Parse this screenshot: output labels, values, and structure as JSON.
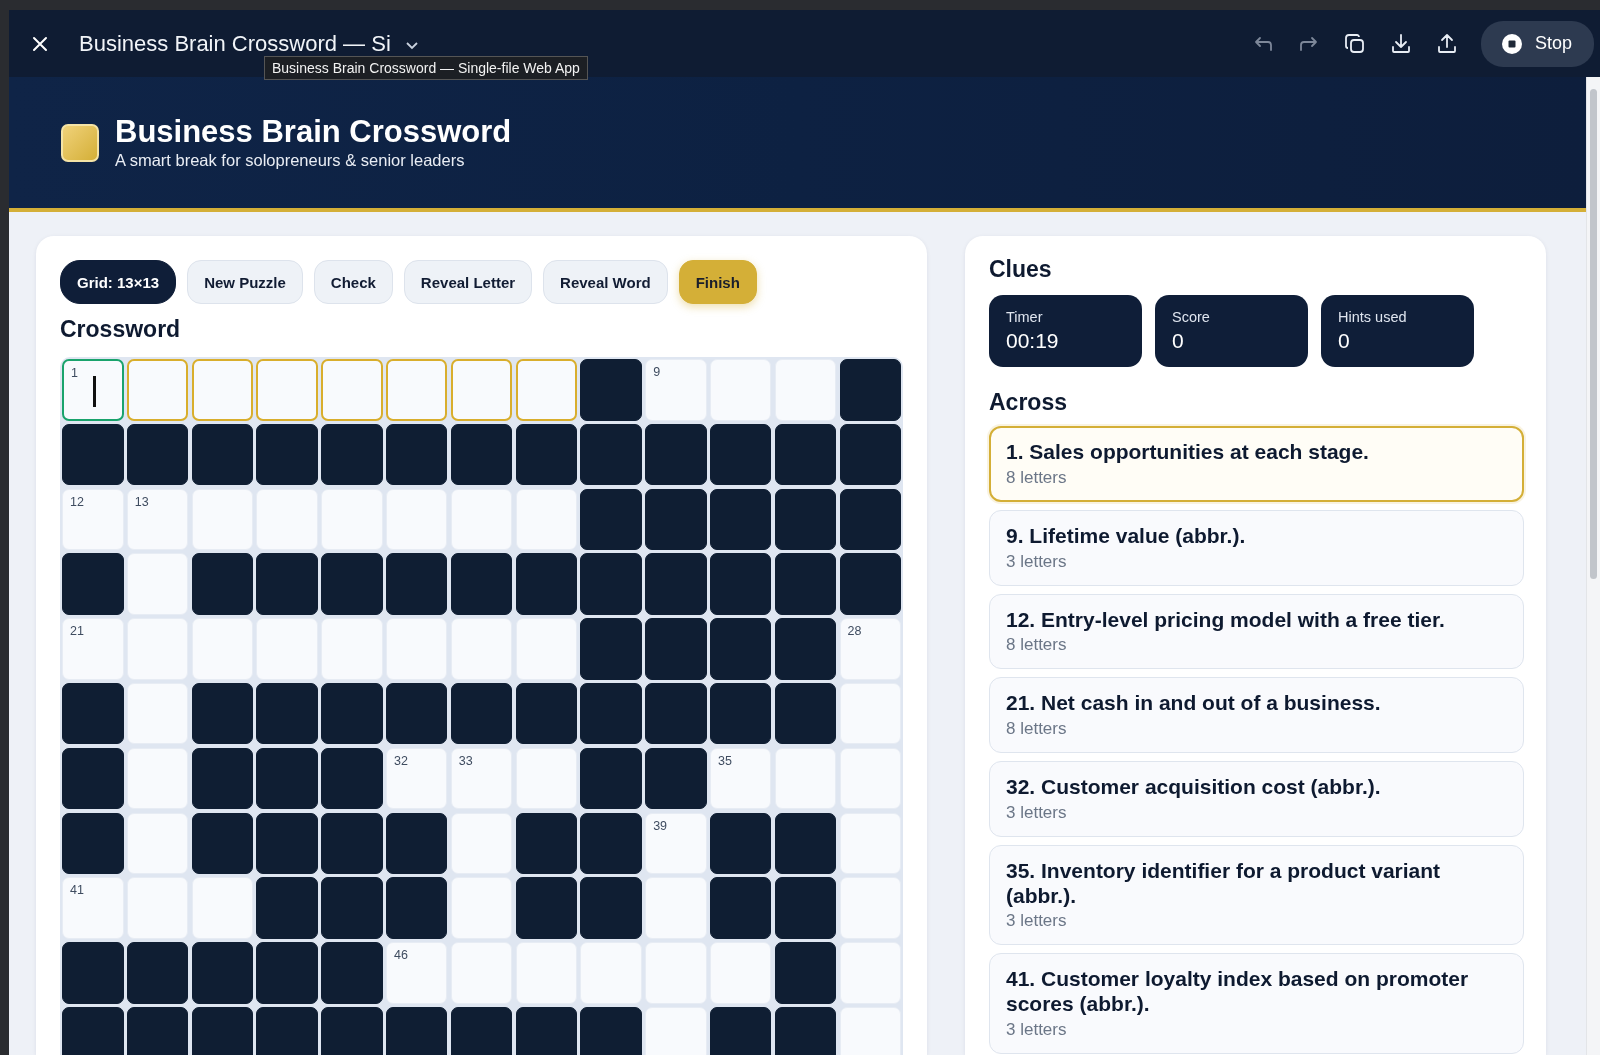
{
  "topbar": {
    "title": "Business Brain Crossword — Si",
    "tooltip": "Business Brain Crossword — Single-file Web App",
    "tools": [
      {
        "kind": "undo",
        "disabled": true
      },
      {
        "kind": "redo",
        "disabled": true
      },
      {
        "kind": "copy",
        "disabled": false
      },
      {
        "kind": "download",
        "disabled": false
      },
      {
        "kind": "upload",
        "disabled": false
      }
    ],
    "stop_button": "Stop"
  },
  "header": {
    "title": "Business Brain Crossword",
    "subtitle": "A smart break for solopreneurs & senior leaders"
  },
  "controls": [
    {
      "label": "Grid: 13×13",
      "kind": "info"
    },
    {
      "label": "New Puzzle",
      "kind": "default"
    },
    {
      "label": "Check",
      "kind": "default"
    },
    {
      "label": "Reveal Letter",
      "kind": "default"
    },
    {
      "label": "Reveal Word",
      "kind": "default"
    },
    {
      "label": "Finish",
      "kind": "primary"
    }
  ],
  "crossword": {
    "title": "Crossword",
    "rows": [
      [
        {
          "block": false,
          "number": "1",
          "selected": true,
          "in_word": true
        },
        {
          "block": false,
          "selected": false,
          "in_word": true
        },
        {
          "block": false,
          "selected": false,
          "in_word": true
        },
        {
          "block": false,
          "selected": false,
          "in_word": true
        },
        {
          "block": false,
          "selected": false,
          "in_word": true
        },
        {
          "block": false,
          "selected": false,
          "in_word": true
        },
        {
          "block": false,
          "selected": false,
          "in_word": true
        },
        {
          "block": false,
          "selected": false,
          "in_word": true
        },
        {
          "block": true
        },
        {
          "block": false,
          "number": "9",
          "selected": false,
          "in_word": false
        },
        {
          "block": false,
          "selected": false,
          "in_word": false
        },
        {
          "block": false,
          "selected": false,
          "in_word": false
        },
        {
          "block": true
        }
      ],
      [
        {
          "block": true
        },
        {
          "block": true
        },
        {
          "block": true
        },
        {
          "block": true
        },
        {
          "block": true
        },
        {
          "block": true
        },
        {
          "block": true
        },
        {
          "block": true
        },
        {
          "block": true
        },
        {
          "block": true
        },
        {
          "block": true
        },
        {
          "block": true
        },
        {
          "block": true
        }
      ],
      [
        {
          "block": false,
          "number": "12",
          "selected": false,
          "in_word": false
        },
        {
          "block": false,
          "number": "13",
          "selected": false,
          "in_word": false
        },
        {
          "block": false,
          "selected": false,
          "in_word": false
        },
        {
          "block": false,
          "selected": false,
          "in_word": false
        },
        {
          "block": false,
          "selected": false,
          "in_word": false
        },
        {
          "block": false,
          "selected": false,
          "in_word": false
        },
        {
          "block": false,
          "selected": false,
          "in_word": false
        },
        {
          "block": false,
          "selected": false,
          "in_word": false
        },
        {
          "block": true
        },
        {
          "block": true
        },
        {
          "block": true
        },
        {
          "block": true
        },
        {
          "block": true
        }
      ],
      [
        {
          "block": true
        },
        {
          "block": false,
          "selected": false,
          "in_word": false
        },
        {
          "block": true
        },
        {
          "block": true
        },
        {
          "block": true
        },
        {
          "block": true
        },
        {
          "block": true
        },
        {
          "block": true
        },
        {
          "block": true
        },
        {
          "block": true
        },
        {
          "block": true
        },
        {
          "block": true
        },
        {
          "block": true
        }
      ],
      [
        {
          "block": false,
          "number": "21",
          "selected": false,
          "in_word": false
        },
        {
          "block": false,
          "selected": false,
          "in_word": false
        },
        {
          "block": false,
          "selected": false,
          "in_word": false
        },
        {
          "block": false,
          "selected": false,
          "in_word": false
        },
        {
          "block": false,
          "selected": false,
          "in_word": false
        },
        {
          "block": false,
          "selected": false,
          "in_word": false
        },
        {
          "block": false,
          "selected": false,
          "in_word": false
        },
        {
          "block": false,
          "selected": false,
          "in_word": false
        },
        {
          "block": true
        },
        {
          "block": true
        },
        {
          "block": true
        },
        {
          "block": true
        },
        {
          "block": false,
          "number": "28",
          "selected": false,
          "in_word": false
        }
      ],
      [
        {
          "block": true
        },
        {
          "block": false,
          "selected": false,
          "in_word": false
        },
        {
          "block": true
        },
        {
          "block": true
        },
        {
          "block": true
        },
        {
          "block": true
        },
        {
          "block": true
        },
        {
          "block": true
        },
        {
          "block": true
        },
        {
          "block": true
        },
        {
          "block": true
        },
        {
          "block": true
        },
        {
          "block": false,
          "selected": false,
          "in_word": false
        }
      ],
      [
        {
          "block": true
        },
        {
          "block": false,
          "selected": false,
          "in_word": false
        },
        {
          "block": true
        },
        {
          "block": true
        },
        {
          "block": true
        },
        {
          "block": false,
          "number": "32",
          "selected": false,
          "in_word": false
        },
        {
          "block": false,
          "number": "33",
          "selected": false,
          "in_word": false
        },
        {
          "block": false,
          "selected": false,
          "in_word": false
        },
        {
          "block": true
        },
        {
          "block": true
        },
        {
          "block": false,
          "number": "35",
          "selected": false,
          "in_word": false
        },
        {
          "block": false,
          "selected": false,
          "in_word": false
        },
        {
          "block": false,
          "selected": false,
          "in_word": false
        }
      ],
      [
        {
          "block": true
        },
        {
          "block": false,
          "selected": false,
          "in_word": false
        },
        {
          "block": true
        },
        {
          "block": true
        },
        {
          "block": true
        },
        {
          "block": true
        },
        {
          "block": false,
          "selected": false,
          "in_word": false
        },
        {
          "block": true
        },
        {
          "block": true
        },
        {
          "block": false,
          "number": "39",
          "selected": false,
          "in_word": false
        },
        {
          "block": true
        },
        {
          "block": true
        },
        {
          "block": false,
          "selected": false,
          "in_word": false
        }
      ],
      [
        {
          "block": false,
          "number": "41",
          "selected": false,
          "in_word": false
        },
        {
          "block": false,
          "selected": false,
          "in_word": false
        },
        {
          "block": false,
          "selected": false,
          "in_word": false
        },
        {
          "block": true
        },
        {
          "block": true
        },
        {
          "block": true
        },
        {
          "block": false,
          "selected": false,
          "in_word": false
        },
        {
          "block": true
        },
        {
          "block": true
        },
        {
          "block": false,
          "selected": false,
          "in_word": false
        },
        {
          "block": true
        },
        {
          "block": true
        },
        {
          "block": false,
          "selected": false,
          "in_word": false
        }
      ],
      [
        {
          "block": true
        },
        {
          "block": true
        },
        {
          "block": true
        },
        {
          "block": true
        },
        {
          "block": true
        },
        {
          "block": false,
          "number": "46",
          "selected": false,
          "in_word": false
        },
        {
          "block": false,
          "selected": false,
          "in_word": false
        },
        {
          "block": false,
          "selected": false,
          "in_word": false
        },
        {
          "block": false,
          "selected": false,
          "in_word": false
        },
        {
          "block": false,
          "selected": false,
          "in_word": false
        },
        {
          "block": false,
          "selected": false,
          "in_word": false
        },
        {
          "block": true
        },
        {
          "block": false,
          "selected": false,
          "in_word": false
        }
      ],
      [
        {
          "block": true
        },
        {
          "block": true
        },
        {
          "block": true
        },
        {
          "block": true
        },
        {
          "block": true
        },
        {
          "block": true
        },
        {
          "block": true
        },
        {
          "block": true
        },
        {
          "block": true
        },
        {
          "block": false,
          "selected": false,
          "in_word": false
        },
        {
          "block": true
        },
        {
          "block": true
        },
        {
          "block": false,
          "selected": false,
          "in_word": false
        }
      ]
    ]
  },
  "clues_panel": {
    "title": "Clues",
    "stats": [
      {
        "label": "Timer",
        "value": "00:19"
      },
      {
        "label": "Score",
        "value": "0"
      },
      {
        "label": "Hints used",
        "value": "0"
      }
    ],
    "across_title": "Across",
    "across": [
      {
        "text": "1. Sales opportunities at each stage.",
        "length": "8 letters",
        "selected": true
      },
      {
        "text": "9. Lifetime value (abbr.).",
        "length": "3 letters",
        "selected": false
      },
      {
        "text": "12. Entry-level pricing model with a free tier.",
        "length": "8 letters",
        "selected": false
      },
      {
        "text": "21. Net cash in and out of a business.",
        "length": "8 letters",
        "selected": false
      },
      {
        "text": "32. Customer acquisition cost (abbr.).",
        "length": "3 letters",
        "selected": false
      },
      {
        "text": "35. Inventory identifier for a product variant (abbr.).",
        "length": "3 letters",
        "selected": false
      },
      {
        "text": "41. Customer loyalty index based on promoter scores (abbr.).",
        "length": "3 letters",
        "selected": false
      }
    ]
  }
}
